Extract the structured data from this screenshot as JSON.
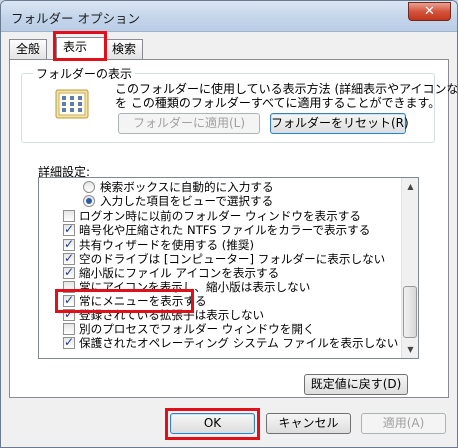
{
  "window": {
    "title": "フォルダー オプション",
    "close_glyph": "✕"
  },
  "tabs": [
    {
      "label": "全般"
    },
    {
      "label": "表示"
    },
    {
      "label": "検索"
    }
  ],
  "folder_view": {
    "group_label": "フォルダーの表示",
    "desc_line1": "このフォルダーに使用している表示方法 (詳細表示やアイコンなど)",
    "desc_line2": "を この種類のフォルダーすべてに適用することができます。",
    "apply_button": "フォルダーに適用(L)",
    "reset_button": "フォルダーをリセット(R)"
  },
  "advanced": {
    "label": "詳細設定:",
    "items": [
      {
        "text": "検索ボックスに自動的に入力する",
        "kind": "radio",
        "checked": false
      },
      {
        "text": "入力した項目をビューで選択する",
        "kind": "radio",
        "checked": true
      },
      {
        "text": "ログオン時に以前のフォルダー ウィンドウを表示する",
        "kind": "checkbox",
        "checked": false
      },
      {
        "text": "暗号化や圧縮された NTFS ファイルをカラーで表示する",
        "kind": "checkbox",
        "checked": true
      },
      {
        "text": "共有ウィザードを使用する (推奨)",
        "kind": "checkbox",
        "checked": true
      },
      {
        "text": "空のドライブは [コンピューター] フォルダーに表示しない",
        "kind": "checkbox",
        "checked": true
      },
      {
        "text": "縮小版にファイル アイコンを表示する",
        "kind": "checkbox",
        "checked": true
      },
      {
        "text": "常にアイコンを表示し、縮小版は表示しない",
        "kind": "checkbox",
        "checked": false
      },
      {
        "text": "常にメニューを表示する",
        "kind": "checkbox",
        "checked": true
      },
      {
        "text": "登録されている拡張子は表示しない",
        "kind": "checkbox",
        "checked": true
      },
      {
        "text": "別のプロセスでフォルダー ウィンドウを開く",
        "kind": "checkbox",
        "checked": false
      },
      {
        "text": "保護されたオペレーティング システム ファイルを表示しない (推奨)",
        "kind": "checkbox",
        "checked": true
      }
    ],
    "scroll_up": "▲",
    "scroll_down": "▼",
    "restore_button": "既定値に戻す(D)"
  },
  "footer": {
    "ok": "OK",
    "cancel": "キャンセル",
    "apply": "適用(A)"
  },
  "colors": {
    "highlight": "#e0101a",
    "check": "#263f85"
  }
}
